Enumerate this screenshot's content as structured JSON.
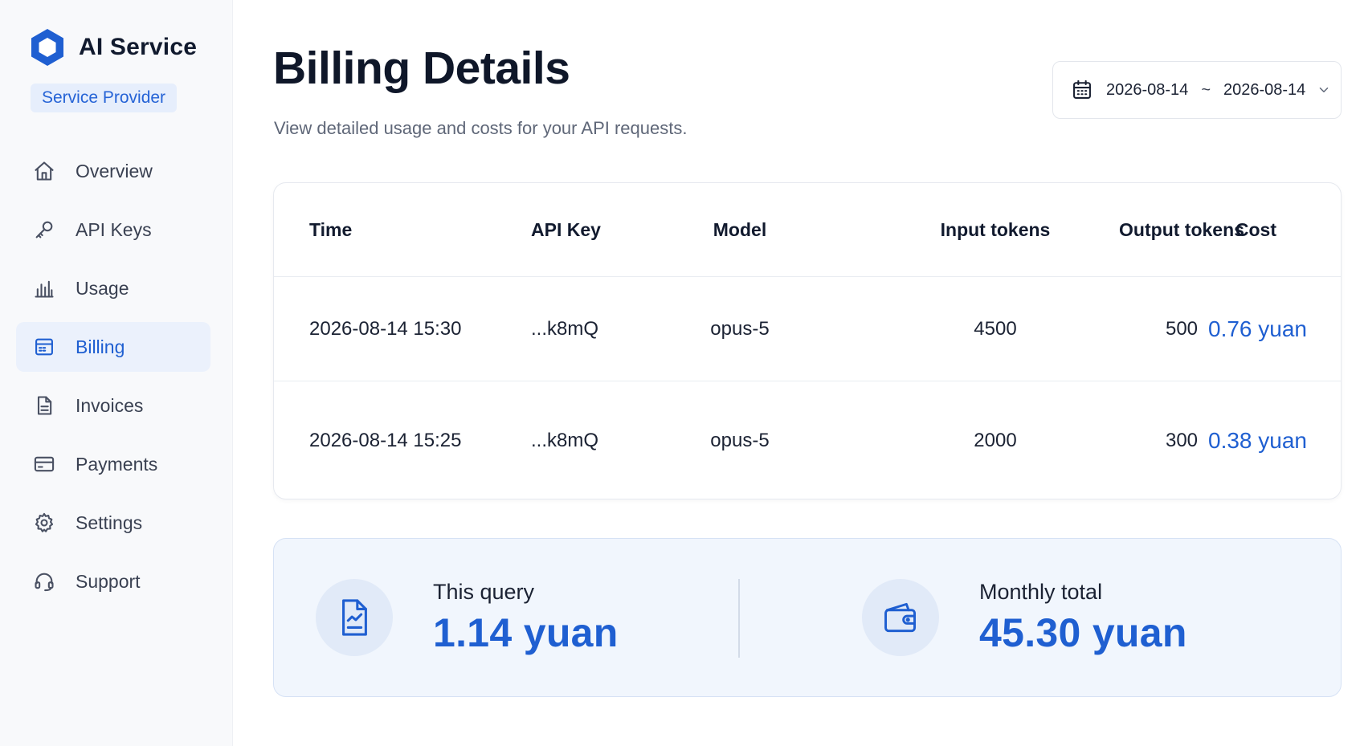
{
  "brand": {
    "name": "AI Service",
    "badge": "Service Provider"
  },
  "nav": [
    {
      "id": "overview",
      "label": "Overview",
      "icon": "home-icon"
    },
    {
      "id": "api-keys",
      "label": "API Keys",
      "icon": "key-icon"
    },
    {
      "id": "usage",
      "label": "Usage",
      "icon": "bar-chart-icon"
    },
    {
      "id": "billing",
      "label": "Billing",
      "icon": "billing-icon",
      "active": true
    },
    {
      "id": "invoices",
      "label": "Invoices",
      "icon": "document-icon"
    },
    {
      "id": "payments",
      "label": "Payments",
      "icon": "credit-card-icon"
    },
    {
      "id": "settings",
      "label": "Settings",
      "icon": "gear-icon"
    },
    {
      "id": "support",
      "label": "Support",
      "icon": "headset-icon"
    }
  ],
  "page": {
    "title": "Billing Details",
    "subtitle": "View detailed usage and costs for your API requests."
  },
  "date_range": {
    "start": "2026-08-14",
    "separator": "~",
    "end": "2026-08-14"
  },
  "table": {
    "columns": [
      "Time",
      "API Key",
      "Model",
      "Input tokens",
      "Output tokens",
      "Cost"
    ],
    "rows": [
      {
        "time": "2026-08-14 15:30",
        "api_key": "...k8mQ",
        "model": "opus-5",
        "input_tokens": "4500",
        "output_tokens": "500",
        "cost": "0.76 yuan"
      },
      {
        "time": "2026-08-14 15:25",
        "api_key": "...k8mQ",
        "model": "opus-5",
        "input_tokens": "2000",
        "output_tokens": "300",
        "cost": "0.38 yuan"
      }
    ]
  },
  "summary": {
    "query": {
      "label": "This query",
      "value": "1.14 yuan",
      "icon": "report-icon"
    },
    "monthly": {
      "label": "Monthly total",
      "value": "45.30 yuan",
      "icon": "wallet-icon"
    }
  },
  "colors": {
    "accent": "#1f5fd1",
    "badge_bg": "#e6eefc",
    "active_bg": "#ebf1fc",
    "summary_bg": "#f1f6fd"
  }
}
